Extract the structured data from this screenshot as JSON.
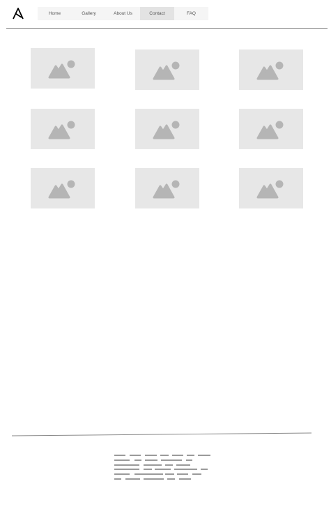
{
  "header": {
    "logo_icon": "ansible-logo-icon",
    "nav": [
      {
        "label": "Home",
        "active": false
      },
      {
        "label": "Gallery",
        "active": false
      },
      {
        "label": "About Us",
        "active": false
      },
      {
        "label": "Contact",
        "active": true
      },
      {
        "label": "FAQ",
        "active": false
      }
    ]
  },
  "gallery": {
    "image_icon": "image-placeholder-icon",
    "rows": 3,
    "columns": 3
  },
  "footer": {
    "text_placeholder_icon": "text-lines-placeholder"
  },
  "colors": {
    "placeholder_bg": "#e7e7e7",
    "placeholder_icon": "#b5b5b5",
    "active_tab": "#e3e3e3",
    "rule": "#888888"
  }
}
